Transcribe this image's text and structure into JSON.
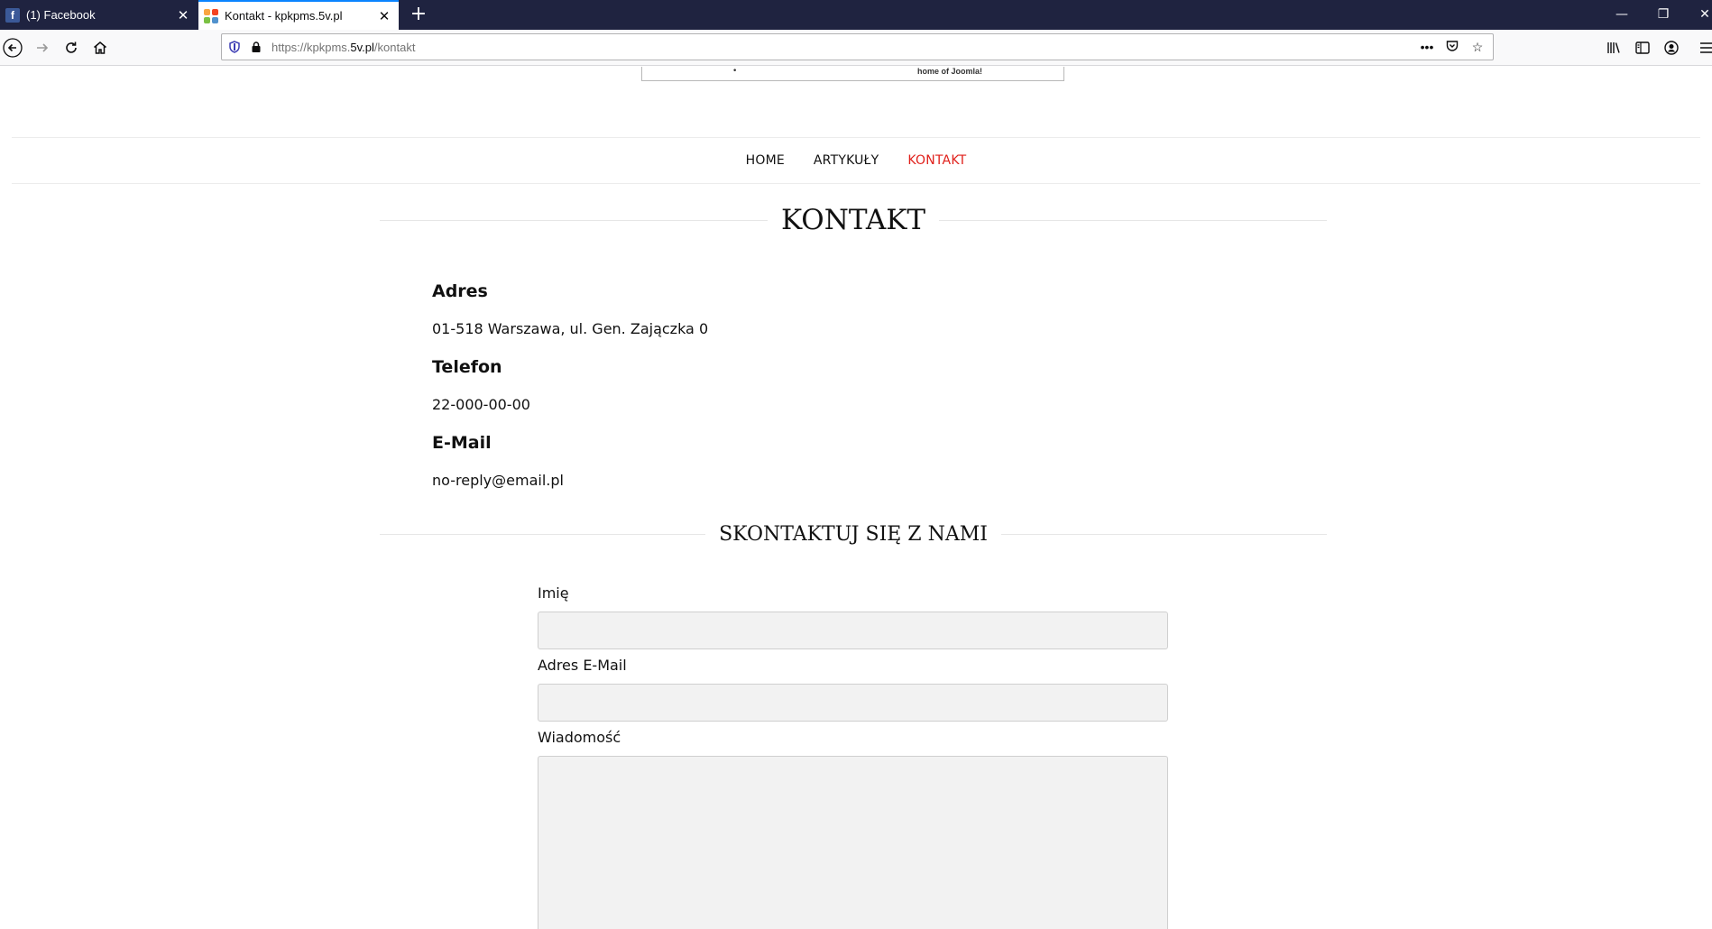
{
  "browser": {
    "tabs": [
      {
        "title": "(1) Facebook",
        "icon": "facebook-icon",
        "active": false
      },
      {
        "title": "Kontakt - kpkpms.5v.pl",
        "icon": "joomla-icon",
        "active": true
      }
    ],
    "url_prefix": "https://kpkpms.",
    "url_domain": "5v.pl",
    "url_path": "/kontakt"
  },
  "banner": {
    "text": "home of Joomla!"
  },
  "nav": {
    "items": [
      {
        "label": "HOME",
        "active": false
      },
      {
        "label": "ARTYKUŁY",
        "active": false
      },
      {
        "label": "KONTAKT",
        "active": true
      }
    ],
    "active_color": "#e0201b"
  },
  "contact": {
    "title": "KONTAKT",
    "address_heading": "Adres",
    "address_value": "01-518 Warszawa, ul. Gen. Zajączka 0",
    "phone_heading": "Telefon",
    "phone_value": "22-000-00-00",
    "email_heading": "E-Mail",
    "email_value": "no-reply@email.pl"
  },
  "form": {
    "title": "SKONTAKTUJ SIĘ Z NAMI",
    "name_label": "Imię",
    "name_value": "",
    "email_label": "Adres E-Mail",
    "email_value": "",
    "message_label": "Wiadomość",
    "message_value": ""
  }
}
